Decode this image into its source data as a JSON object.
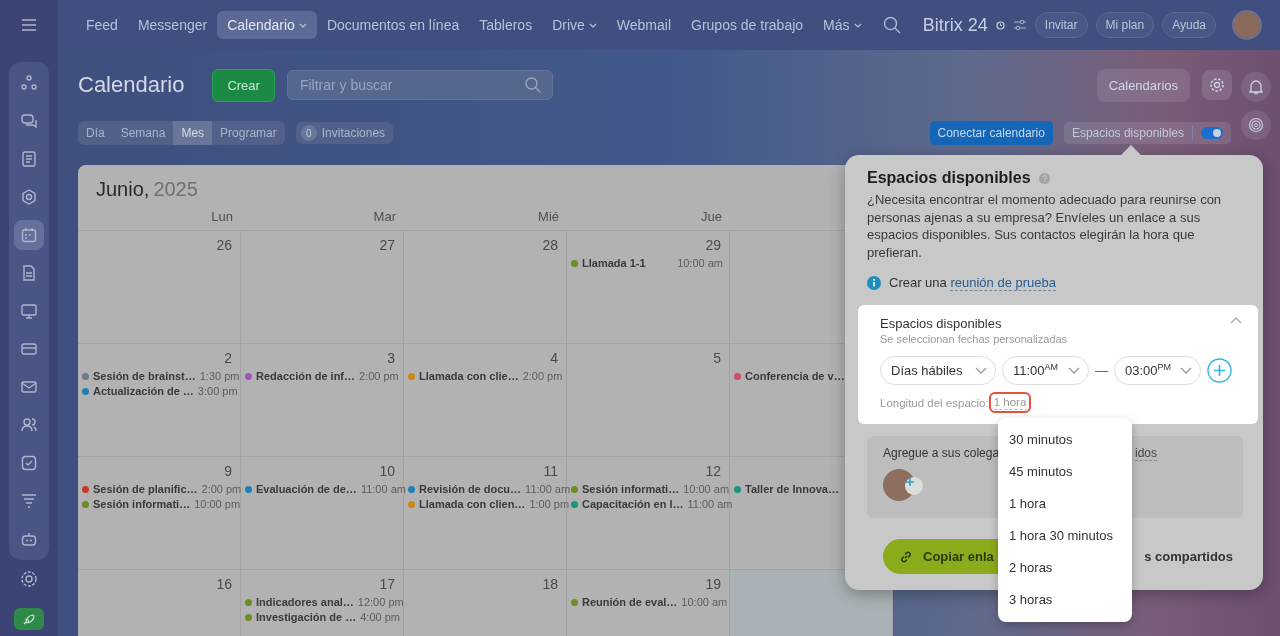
{
  "topnav": {
    "items": [
      {
        "label": "Feed",
        "selected": false,
        "dropdown": false
      },
      {
        "label": "Messenger",
        "selected": false,
        "dropdown": false
      },
      {
        "label": "Calendario",
        "selected": true,
        "dropdown": true
      },
      {
        "label": "Documentos en línea",
        "selected": false,
        "dropdown": false
      },
      {
        "label": "Tableros",
        "selected": false,
        "dropdown": false
      },
      {
        "label": "Drive",
        "selected": false,
        "dropdown": true
      },
      {
        "label": "Webmail",
        "selected": false,
        "dropdown": false
      },
      {
        "label": "Grupos de trabajo",
        "selected": false,
        "dropdown": false
      },
      {
        "label": "Más",
        "selected": false,
        "dropdown": true
      }
    ],
    "logo": "Bitrix 24",
    "actions": [
      "Invitar",
      "Mi plan",
      "Ayuda"
    ]
  },
  "header": {
    "title": "Calendario",
    "create_button": "Crear",
    "search": {
      "placeholder": "Filtrar y buscar"
    },
    "calendars_button": "Calendarios"
  },
  "view_tabs": [
    {
      "label": "Día",
      "selected": false
    },
    {
      "label": "Semana",
      "selected": false
    },
    {
      "label": "Mes",
      "selected": true
    },
    {
      "label": "Programar",
      "selected": false
    }
  ],
  "invitations": {
    "count": "0",
    "label": "Invitaciones"
  },
  "connect_button": "Conectar calendario",
  "slots_toggle": {
    "label": "Espacios disponibles",
    "on": true
  },
  "calendar": {
    "month": "Junio,",
    "year": "2025",
    "weekdays": [
      "Lun",
      "Mar",
      "Mié",
      "Jue"
    ],
    "weeks": [
      [
        {
          "date": "26"
        },
        {
          "date": "27"
        },
        {
          "date": "28"
        },
        {
          "date": "29",
          "events": [
            {
              "title": "Llamada 1-1",
              "time": "10:00 am",
              "color": "#6b8e23"
            }
          ]
        }
      ],
      [
        {
          "date": "2",
          "events": [
            {
              "title": "Sesión de brainst…",
              "time": "1:30 pm",
              "color": "#6b7b8c"
            },
            {
              "title": "Actualización de …",
              "time": "3:00 pm",
              "color": "#1f7fb5"
            }
          ]
        },
        {
          "date": "3",
          "events": [
            {
              "title": "Redacción de inf…",
              "time": "2:00 pm",
              "color": "#a155b9"
            }
          ]
        },
        {
          "date": "4",
          "events": [
            {
              "title": "Llamada con clie…",
              "time": "2:00 pm",
              "color": "#c98a12"
            }
          ]
        },
        {
          "date": "5"
        },
        {
          "events": [
            {
              "title": "Conferencia de v…",
              "color": "#d04a6a"
            }
          ]
        }
      ],
      [
        {
          "date": "9",
          "events": [
            {
              "title": "Sesión de planific…",
              "time": "2:00 pm",
              "color": "#c0392b"
            },
            {
              "title": "Sesión informati…",
              "time": "10:00 pm",
              "color": "#6b8e23"
            }
          ]
        },
        {
          "date": "10",
          "events": [
            {
              "title": "Evaluación de de…",
              "time": "11:00 am",
              "color": "#1f7fb5"
            }
          ]
        },
        {
          "date": "11",
          "events": [
            {
              "title": "Revisión de docu…",
              "time": "11:00 am",
              "color": "#1f7fb5"
            },
            {
              "title": "Llamada con clien…",
              "time": "1:00 pm",
              "color": "#c98a12"
            }
          ]
        },
        {
          "date": "12",
          "events": [
            {
              "title": "Sesión informati…",
              "time": "10:00 am",
              "color": "#6b8e23"
            },
            {
              "title": "Capacitación en l…",
              "time": "11:00 am",
              "color": "#16967f"
            }
          ]
        },
        {
          "events": [
            {
              "title": "Taller de Innova…",
              "color": "#16967f"
            }
          ]
        }
      ],
      [
        {
          "date": "16"
        },
        {
          "date": "17",
          "events": [
            {
              "title": "Indicadores anal…",
              "time": "12:00 pm",
              "color": "#6b8e23"
            },
            {
              "title": "Investigación de …",
              "time": "4:00 pm",
              "color": "#6b8e23"
            }
          ]
        },
        {
          "date": "18"
        },
        {
          "date": "19",
          "events": [
            {
              "title": "Reunión de eval…",
              "time": "10:00 am",
              "color": "#6b8e23"
            }
          ]
        },
        {
          "highlighted": true
        }
      ]
    ]
  },
  "slots_panel": {
    "title": "Espacios disponibles",
    "description": "¿Necesita encontrar el momento adecuado para reunirse con personas ajenas a su empresa? Envíeles un enlace a sus espacios disponibles. Sus contactos elegirán la hora que prefieran.",
    "info": {
      "prefix": "Crear una",
      "link": "reunión de prueba"
    },
    "card": {
      "title": "Espacios disponibles",
      "subtitle": "Se seleccionan fechas personalizadas",
      "expanded": true,
      "days": "Días hábiles",
      "start": "11:00$^{AM}$",
      "separator": "—",
      "end": "03:00$^{PM}$",
      "length_label": "Longitud del espacio:",
      "length_value": "1 hora",
      "length_highlighted": true
    },
    "colleagues": {
      "text": "Agregue a sus colega",
      "link_fragment": "idos"
    },
    "footer": {
      "copy_button": "Copiar enla",
      "shared_link": "s compartidos"
    },
    "dropdown": {
      "options": [
        "30 minutos",
        "45 minutos",
        "1 hora",
        "1 hora 30 minutos",
        "2 horas",
        "3 horas"
      ]
    }
  }
}
